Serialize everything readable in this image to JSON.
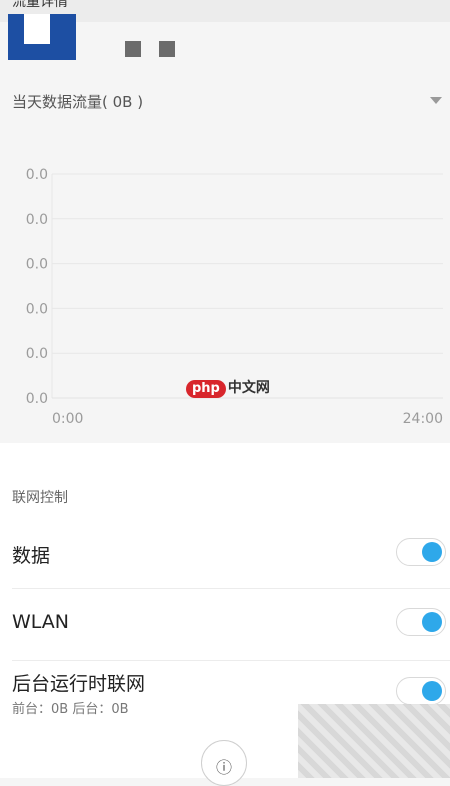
{
  "header": {
    "title": "流量详情"
  },
  "icons": {
    "app": "app-icon",
    "dropdown": "chevron-down-icon",
    "info": "info-icon"
  },
  "traffic": {
    "title": "当天数据流量( 0B )"
  },
  "chart_data": {
    "type": "line",
    "title": "",
    "xlabel": "",
    "ylabel": "",
    "x_ticks": [
      "0:00",
      "24:00"
    ],
    "y_ticks": [
      "0.0",
      "0.0",
      "0.0",
      "0.0",
      "0.0",
      "0.0"
    ],
    "series": [
      {
        "x": [
          "0:00",
          "24:00"
        ],
        "values": [
          0,
          0
        ]
      }
    ],
    "ylim": [
      0,
      0
    ],
    "grid": true
  },
  "watermark": {
    "badge": "php",
    "text": "中文网"
  },
  "network_control": {
    "section_label": "联网控制",
    "rows": [
      {
        "label": "数据",
        "enabled": true
      },
      {
        "label": "WLAN",
        "enabled": true
      },
      {
        "label": "后台运行时联网",
        "sub": "前台：0B  后台：0B",
        "enabled": true
      }
    ]
  },
  "footer": {
    "info_symbol": "ⓘ"
  },
  "colors": {
    "toggle_on": "#2ea8ea",
    "brand_blue": "#1d4fa3",
    "watermark_red": "#d8262c"
  }
}
